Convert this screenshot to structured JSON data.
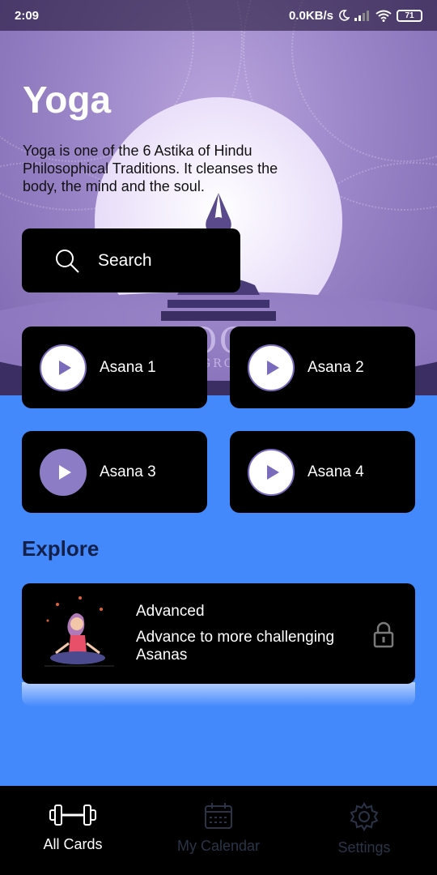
{
  "status_bar": {
    "time": "2:09",
    "network_speed": "0.0KB/s",
    "battery": "71",
    "icons": [
      "moon-icon",
      "signal-icon",
      "wifi-icon",
      "battery-icon"
    ]
  },
  "header": {
    "title": "Yoga",
    "description": "Yoga is one of the 6 Astika of Hindu Philosophical Traditions. It cleanses the body, the mind and the soul.",
    "background_logo_text": "OG",
    "background_logo_subtext": "GRO"
  },
  "search": {
    "label": "Search",
    "icon": "search-icon"
  },
  "asana_cards": [
    {
      "label": "Asana 1",
      "active": false
    },
    {
      "label": "Asana 2",
      "active": false
    },
    {
      "label": "Asana 3",
      "active": true
    },
    {
      "label": "Asana 4",
      "active": false
    }
  ],
  "explore": {
    "heading": "Explore",
    "card": {
      "title": "Advanced",
      "description": "Advance to more challenging Asanas",
      "icon": "lock-icon"
    }
  },
  "bottom_nav": {
    "items": [
      {
        "label": "All Cards",
        "icon": "dumbbell-icon",
        "active": true
      },
      {
        "label": "My Calendar",
        "icon": "calendar-icon",
        "active": false
      },
      {
        "label": "Settings",
        "icon": "gear-icon",
        "active": false
      }
    ]
  },
  "colors": {
    "background_blue": "#4489fc",
    "card_black": "#000000",
    "accent_purple": "#7b6bbd",
    "active_play": "#8c7cc6",
    "heading_dark": "#12204a"
  }
}
